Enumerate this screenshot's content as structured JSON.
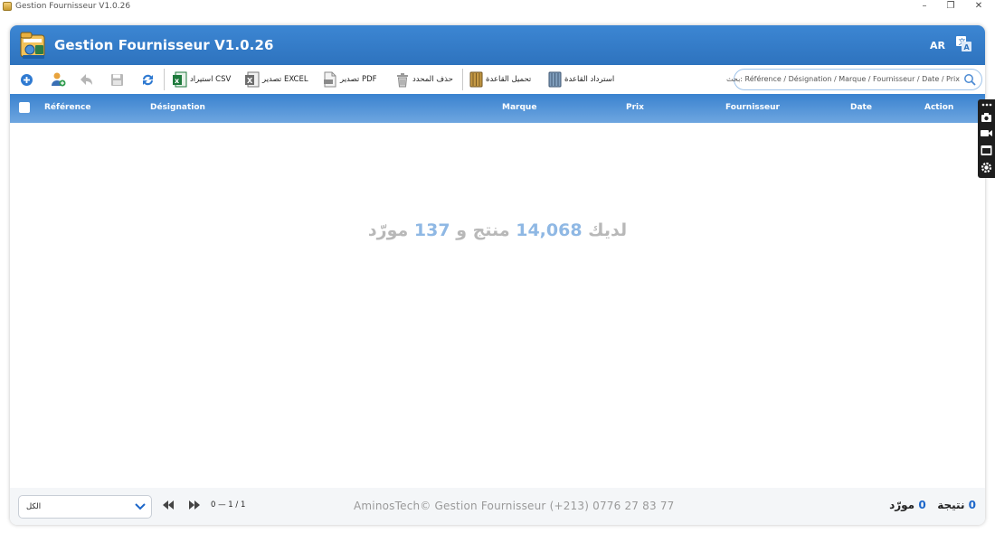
{
  "window": {
    "title": "Gestion Fournisseur V1.0.26",
    "minimize": "–",
    "restore": "❐",
    "close": "✕"
  },
  "header": {
    "title": "Gestion Fournisseur V1.0.26",
    "lang": "AR",
    "logo_icon": "supplier-folder-logo",
    "translate_icon": "translate-icon"
  },
  "toolbar": {
    "import_csv": "استيراد CSV",
    "export_excel": "تصدير EXCEL",
    "export_pdf": "تصدير PDF",
    "delete_selected": "حذف المحدد",
    "load_db": "تحميل القاعدة",
    "restore_db": "استرداد القاعدة",
    "search_placeholder": "بحث: Référence / Désignation / Marque / Fournisseur / Date / Prix"
  },
  "table": {
    "columns": [
      "Référence",
      "Désignation",
      "Marque",
      "Prix",
      "Fournisseur",
      "Date",
      "Action"
    ],
    "rows": []
  },
  "summary": {
    "prefix": "لديك",
    "products_count": "14,068",
    "products_word": "منتج و",
    "suppliers_count": "137",
    "suppliers_word": "مورّد"
  },
  "footer": {
    "filter_value": "الكل",
    "page_info": "0 — 1 / 1",
    "copyright": "AminosTech© Gestion Fournisseur (+213) 0776 27 83 77",
    "results_count": "0",
    "results_label": "نتيجة",
    "suppliers_count": "0",
    "suppliers_label": "مورّد"
  },
  "colors": {
    "primary": "#2e73be",
    "accent": "#1c66c9",
    "summary_num": "#8fb8e4",
    "summary_text": "#b8b8b8"
  }
}
